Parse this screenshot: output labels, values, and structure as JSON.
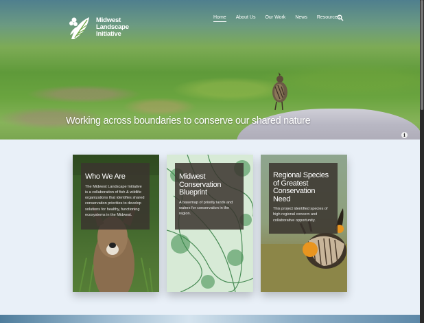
{
  "site": {
    "logo_lines": [
      "Midwest",
      "Landscape",
      "Initiative"
    ]
  },
  "nav": {
    "items": [
      {
        "label": "Home",
        "active": true
      },
      {
        "label": "About Us",
        "active": false
      },
      {
        "label": "Our Work",
        "active": false
      },
      {
        "label": "News",
        "active": false
      },
      {
        "label": "Resources",
        "active": false
      }
    ],
    "search_icon": "search-icon"
  },
  "hero": {
    "tagline": "Working across boundaries to conserve our shared nature",
    "info_icon": "i"
  },
  "cards": [
    {
      "title_lines": [
        "Who We Are"
      ],
      "description": "The Midwest Landscape Initiative is a collaboration of fish & wildlife organizations that identifies shared conservation priorities to develop solutions for healthy, functioning ecosystems in the Midwest."
    },
    {
      "title_lines": [
        "Midwest",
        "Conservation",
        "Blueprint"
      ],
      "description": "A basemap of priority lands and waters for conservation in the region."
    },
    {
      "title_lines": [
        "Regional Species",
        "of Greatest",
        "Conservation",
        "Need"
      ],
      "description": "This project identified species of high regional concern and collaborative opportunity."
    }
  ],
  "colors": {
    "page_bg": "#e9f0f8",
    "card_panel": "#3a342f",
    "text_light": "#ffffff"
  }
}
